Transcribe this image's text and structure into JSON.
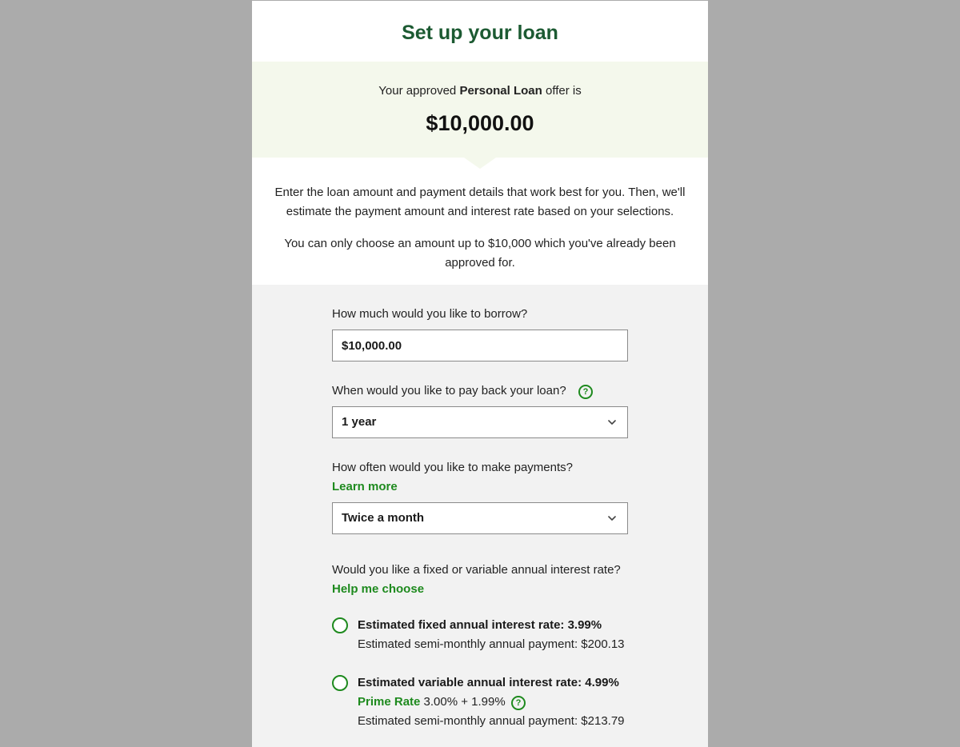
{
  "page": {
    "title": "Set up your loan"
  },
  "offer": {
    "prefix": "Your approved",
    "product": "Personal Loan",
    "suffix": "offer is",
    "amount": "$10,000.00"
  },
  "intro": {
    "paragraph1": "Enter the loan amount and payment details that work best for you. Then, we'll estimate the payment amount and interest rate based on your selections.",
    "paragraph2": "You can only choose an amount up to $10,000 which you've already been approved for."
  },
  "form": {
    "borrow": {
      "label": "How much would you like to borrow?",
      "value": "$10,000.00"
    },
    "term": {
      "label": "When would you like to pay back your loan?",
      "selected": "1 year",
      "help_icon": "question-circle-icon"
    },
    "frequency": {
      "label": "How often would you like to make payments?",
      "link": "Learn more",
      "selected": "Twice a month"
    },
    "rate": {
      "label": "Would you like a fixed or variable annual interest rate?",
      "link": "Help me choose",
      "fixed": {
        "title": "Estimated fixed annual interest rate: 3.99%",
        "payment": "Estimated semi-monthly annual payment: $200.13"
      },
      "variable": {
        "title": "Estimated variable annual interest rate: 4.99%",
        "prime_label": "Prime Rate",
        "prime_detail": "3.00% + 1.99%",
        "payment": "Estimated semi-monthly annual payment: $213.79"
      }
    }
  },
  "colors": {
    "title_green": "#1c5a32",
    "accent_green": "#1e8a1e",
    "offer_bg": "#f4f8ec",
    "form_bg": "#f2f2f2",
    "page_bg": "#ababab"
  }
}
